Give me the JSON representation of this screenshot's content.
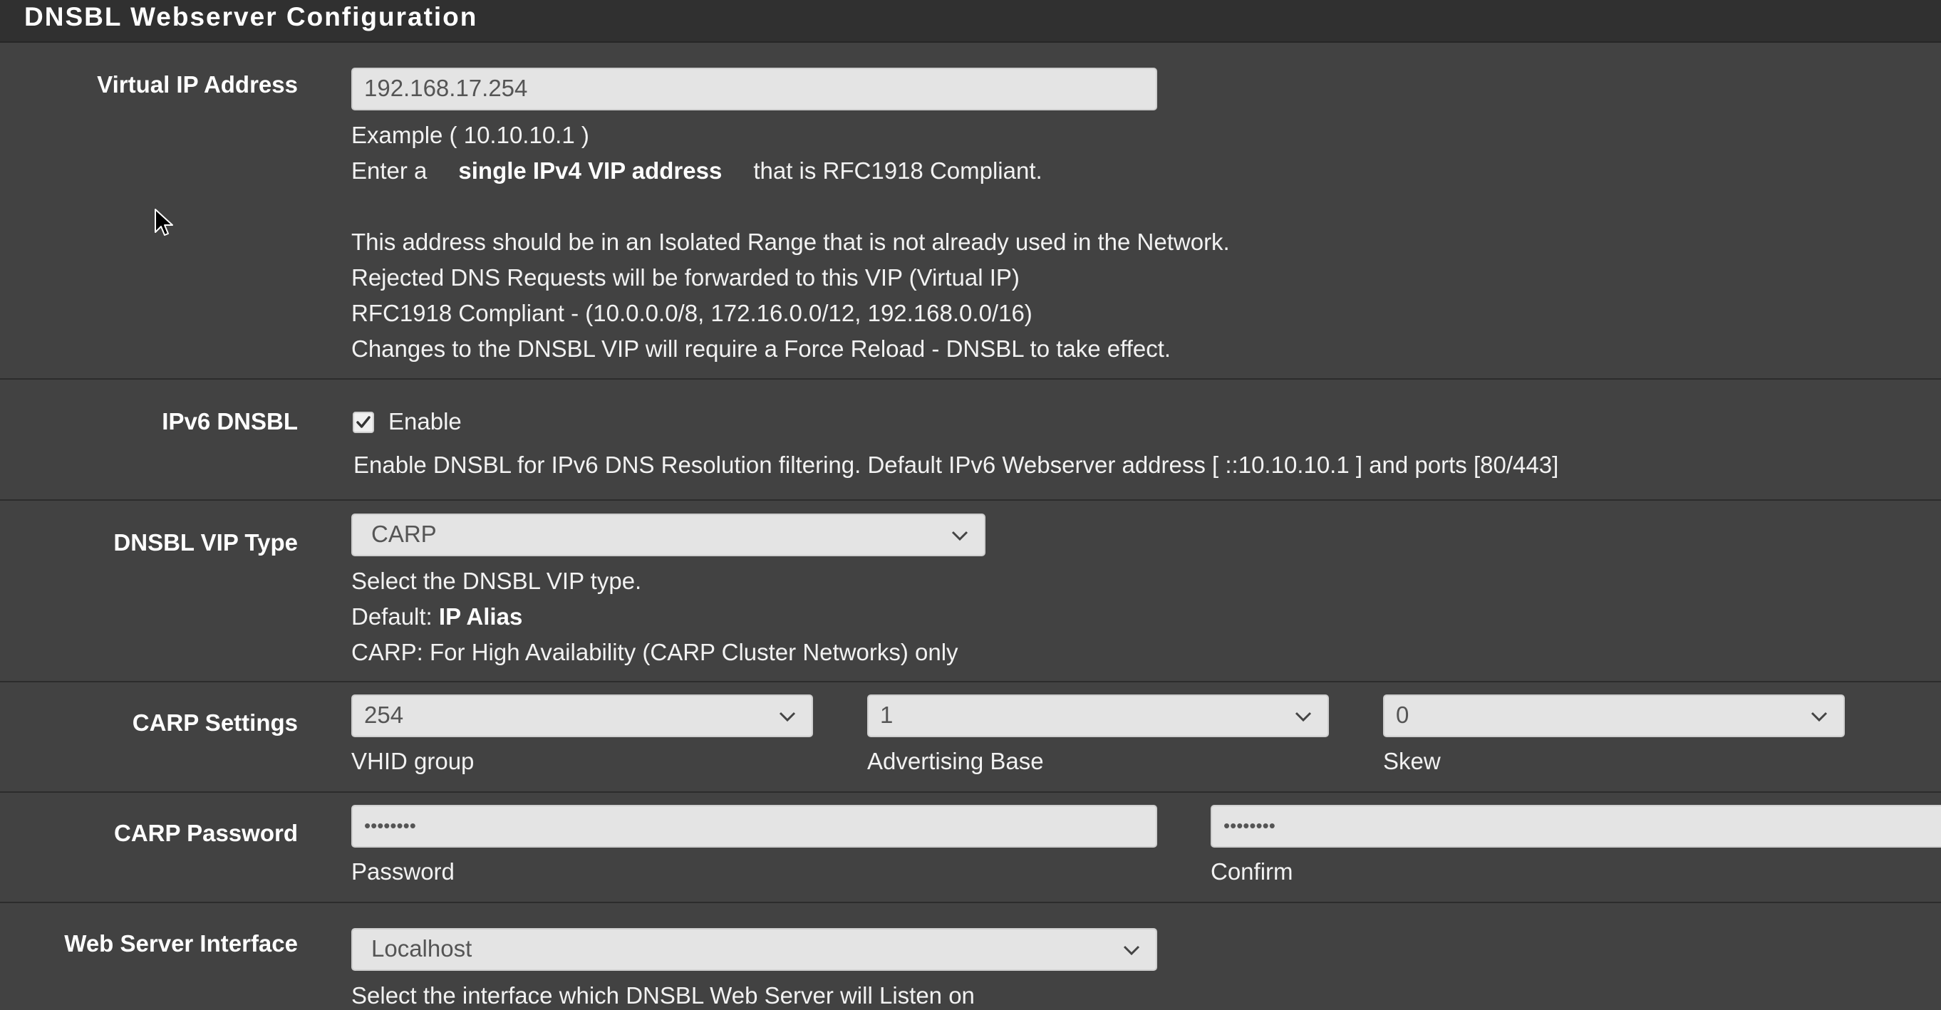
{
  "panel": {
    "title": "DNSBL Webserver Configuration"
  },
  "vip": {
    "label": "Virtual IP Address",
    "value": "192.168.17.254",
    "example": "Example ( 10.10.10.1 )",
    "enter_prefix": "Enter a",
    "enter_bold": "single IPv4 VIP address",
    "enter_suffix": "that is RFC1918 Compliant.",
    "note1": "This address should be in an Isolated Range that is not already used in the Network.",
    "note2": "Rejected DNS Requests will be forwarded to this VIP (Virtual IP)",
    "note3": "RFC1918 Compliant - (10.0.0.0/8, 172.16.0.0/12, 192.168.0.0/16)",
    "note4": "Changes to the DNSBL VIP will require a Force Reload - DNSBL to take effect."
  },
  "ipv6": {
    "label": "IPv6 DNSBL",
    "checkbox_label": "Enable",
    "checked": true,
    "help": "Enable DNSBL for IPv6 DNS Resolution filtering. Default IPv6 Webserver address [ ::10.10.10.1 ] and ports [80/443]"
  },
  "vip_type": {
    "label": "DNSBL VIP Type",
    "selected": "CARP",
    "help1": "Select the DNSBL VIP type.",
    "help2_prefix": "Default:",
    "help2_bold": "IP Alias",
    "help3": "CARP: For High Availability (CARP Cluster Networks) only"
  },
  "carp": {
    "label": "CARP Settings",
    "vhid_value": "254",
    "vhid_label": "VHID group",
    "advbase_value": "1",
    "advbase_label": "Advertising Base",
    "skew_value": "0",
    "skew_label": "Skew"
  },
  "carp_password": {
    "label": "CARP Password",
    "password_value": "••••••••",
    "password_label": "Password",
    "confirm_value": "••••••••",
    "confirm_label": "Confirm"
  },
  "web_interface": {
    "label": "Web Server Interface",
    "selected": "Localhost",
    "help": "Select the interface which DNSBL Web Server will Listen on"
  },
  "icons": {
    "chevron": "chevron-down-icon",
    "check": "check-icon",
    "cursor": "mouse-pointer-icon"
  }
}
